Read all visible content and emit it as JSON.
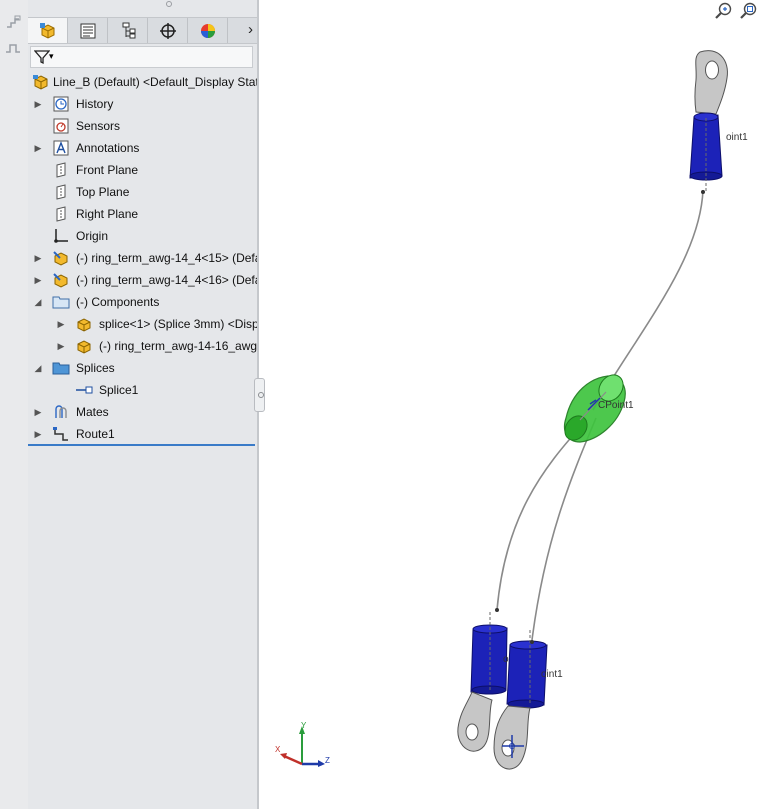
{
  "filter_dropdown": "▾",
  "tree": {
    "root": "Line_B (Default) <Default_Display State",
    "items": [
      {
        "label": "History",
        "icon": "history-icon",
        "arrow": "right"
      },
      {
        "label": "Sensors",
        "icon": "sensors-icon",
        "arrow": ""
      },
      {
        "label": "Annotations",
        "icon": "annotations-icon",
        "arrow": "right"
      },
      {
        "label": "Front Plane",
        "icon": "plane-icon",
        "arrow": ""
      },
      {
        "label": "Top Plane",
        "icon": "plane-icon",
        "arrow": ""
      },
      {
        "label": "Right Plane",
        "icon": "plane-icon",
        "arrow": ""
      },
      {
        "label": "Origin",
        "icon": "origin-icon",
        "arrow": ""
      },
      {
        "label": "(-) ring_term_awg-14_4<15> (Defa",
        "icon": "part-edit-icon",
        "arrow": "right"
      },
      {
        "label": "(-) ring_term_awg-14_4<16> (Defa",
        "icon": "part-edit-icon",
        "arrow": "right"
      },
      {
        "label": "(-) Components",
        "icon": "folder-icon",
        "arrow": "down"
      },
      {
        "label": "splice<1> (Splice 3mm) <Disp",
        "icon": "assembly-part-icon",
        "arrow": "right"
      },
      {
        "label": "(-) ring_term_awg-14-16_awg",
        "icon": "assembly-part-icon",
        "arrow": "right"
      },
      {
        "label": "Splices",
        "icon": "folder-blue-icon",
        "arrow": "down"
      },
      {
        "label": "Splice1",
        "icon": "splice-point-icon",
        "arrow": ""
      },
      {
        "label": "Mates",
        "icon": "mates-icon",
        "arrow": "right"
      },
      {
        "label": "Route1",
        "icon": "route-icon",
        "arrow": "right"
      }
    ]
  },
  "tabs": [
    {
      "name": "feature-manager",
      "icon": "feature-manager-icon"
    },
    {
      "name": "property-manager",
      "icon": "property-manager-icon"
    },
    {
      "name": "configuration-manager",
      "icon": "configuration-manager-icon"
    },
    {
      "name": "dimxpert-manager",
      "icon": "crosshair-icon"
    },
    {
      "name": "display-manager",
      "icon": "color-wheel-icon"
    }
  ],
  "tab_more": "›",
  "viewport": {
    "labels": {
      "top_connector": "oint1",
      "splice": "CPoint1",
      "bottom_left_connector": "oint1",
      "bottom_right_connector": "oint1"
    },
    "triad": {
      "x": "X",
      "y": "Y",
      "z": "Z"
    },
    "colors": {
      "terminal": "#1c22b8",
      "splice": "#3ec43e",
      "ring": "#c6c6c6",
      "wire": "#8a8a8a"
    }
  }
}
